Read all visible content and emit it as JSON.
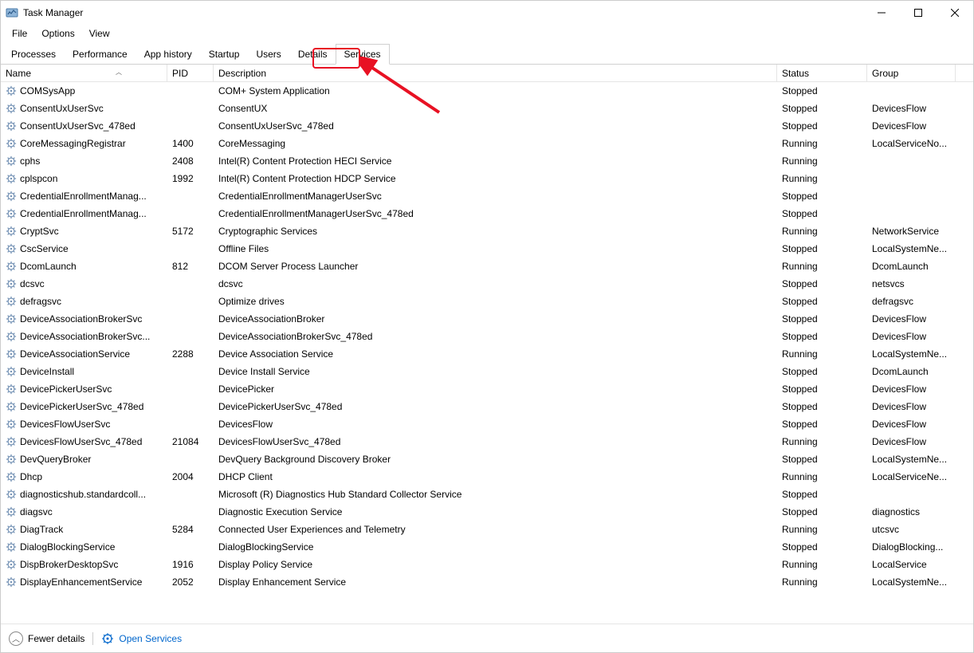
{
  "window": {
    "title": "Task Manager"
  },
  "menu": {
    "file": "File",
    "options": "Options",
    "view": "View"
  },
  "tabs": {
    "processes": "Processes",
    "performance": "Performance",
    "app_history": "App history",
    "startup": "Startup",
    "users": "Users",
    "details": "Details",
    "services": "Services",
    "active": "services"
  },
  "columns": {
    "name": "Name",
    "pid": "PID",
    "description": "Description",
    "status": "Status",
    "group": "Group"
  },
  "services": [
    {
      "name": "COMSysApp",
      "pid": "",
      "desc": "COM+ System Application",
      "status": "Stopped",
      "group": ""
    },
    {
      "name": "ConsentUxUserSvc",
      "pid": "",
      "desc": "ConsentUX",
      "status": "Stopped",
      "group": "DevicesFlow"
    },
    {
      "name": "ConsentUxUserSvc_478ed",
      "pid": "",
      "desc": "ConsentUxUserSvc_478ed",
      "status": "Stopped",
      "group": "DevicesFlow"
    },
    {
      "name": "CoreMessagingRegistrar",
      "pid": "1400",
      "desc": "CoreMessaging",
      "status": "Running",
      "group": "LocalServiceNo..."
    },
    {
      "name": "cphs",
      "pid": "2408",
      "desc": "Intel(R) Content Protection HECI Service",
      "status": "Running",
      "group": ""
    },
    {
      "name": "cplspcon",
      "pid": "1992",
      "desc": "Intel(R) Content Protection HDCP Service",
      "status": "Running",
      "group": ""
    },
    {
      "name": "CredentialEnrollmentManag...",
      "pid": "",
      "desc": "CredentialEnrollmentManagerUserSvc",
      "status": "Stopped",
      "group": ""
    },
    {
      "name": "CredentialEnrollmentManag...",
      "pid": "",
      "desc": "CredentialEnrollmentManagerUserSvc_478ed",
      "status": "Stopped",
      "group": ""
    },
    {
      "name": "CryptSvc",
      "pid": "5172",
      "desc": "Cryptographic Services",
      "status": "Running",
      "group": "NetworkService"
    },
    {
      "name": "CscService",
      "pid": "",
      "desc": "Offline Files",
      "status": "Stopped",
      "group": "LocalSystemNe..."
    },
    {
      "name": "DcomLaunch",
      "pid": "812",
      "desc": "DCOM Server Process Launcher",
      "status": "Running",
      "group": "DcomLaunch"
    },
    {
      "name": "dcsvc",
      "pid": "",
      "desc": "dcsvc",
      "status": "Stopped",
      "group": "netsvcs"
    },
    {
      "name": "defragsvc",
      "pid": "",
      "desc": "Optimize drives",
      "status": "Stopped",
      "group": "defragsvc"
    },
    {
      "name": "DeviceAssociationBrokerSvc",
      "pid": "",
      "desc": "DeviceAssociationBroker",
      "status": "Stopped",
      "group": "DevicesFlow"
    },
    {
      "name": "DeviceAssociationBrokerSvc...",
      "pid": "",
      "desc": "DeviceAssociationBrokerSvc_478ed",
      "status": "Stopped",
      "group": "DevicesFlow"
    },
    {
      "name": "DeviceAssociationService",
      "pid": "2288",
      "desc": "Device Association Service",
      "status": "Running",
      "group": "LocalSystemNe..."
    },
    {
      "name": "DeviceInstall",
      "pid": "",
      "desc": "Device Install Service",
      "status": "Stopped",
      "group": "DcomLaunch"
    },
    {
      "name": "DevicePickerUserSvc",
      "pid": "",
      "desc": "DevicePicker",
      "status": "Stopped",
      "group": "DevicesFlow"
    },
    {
      "name": "DevicePickerUserSvc_478ed",
      "pid": "",
      "desc": "DevicePickerUserSvc_478ed",
      "status": "Stopped",
      "group": "DevicesFlow"
    },
    {
      "name": "DevicesFlowUserSvc",
      "pid": "",
      "desc": "DevicesFlow",
      "status": "Stopped",
      "group": "DevicesFlow"
    },
    {
      "name": "DevicesFlowUserSvc_478ed",
      "pid": "21084",
      "desc": "DevicesFlowUserSvc_478ed",
      "status": "Running",
      "group": "DevicesFlow"
    },
    {
      "name": "DevQueryBroker",
      "pid": "",
      "desc": "DevQuery Background Discovery Broker",
      "status": "Stopped",
      "group": "LocalSystemNe..."
    },
    {
      "name": "Dhcp",
      "pid": "2004",
      "desc": "DHCP Client",
      "status": "Running",
      "group": "LocalServiceNe..."
    },
    {
      "name": "diagnosticshub.standardcoll...",
      "pid": "",
      "desc": "Microsoft (R) Diagnostics Hub Standard Collector Service",
      "status": "Stopped",
      "group": ""
    },
    {
      "name": "diagsvc",
      "pid": "",
      "desc": "Diagnostic Execution Service",
      "status": "Stopped",
      "group": "diagnostics"
    },
    {
      "name": "DiagTrack",
      "pid": "5284",
      "desc": "Connected User Experiences and Telemetry",
      "status": "Running",
      "group": "utcsvc"
    },
    {
      "name": "DialogBlockingService",
      "pid": "",
      "desc": "DialogBlockingService",
      "status": "Stopped",
      "group": "DialogBlocking..."
    },
    {
      "name": "DispBrokerDesktopSvc",
      "pid": "1916",
      "desc": "Display Policy Service",
      "status": "Running",
      "group": "LocalService"
    },
    {
      "name": "DisplayEnhancementService",
      "pid": "2052",
      "desc": "Display Enhancement Service",
      "status": "Running",
      "group": "LocalSystemNe..."
    }
  ],
  "footer": {
    "fewer_details": "Fewer details",
    "open_services": "Open Services"
  }
}
